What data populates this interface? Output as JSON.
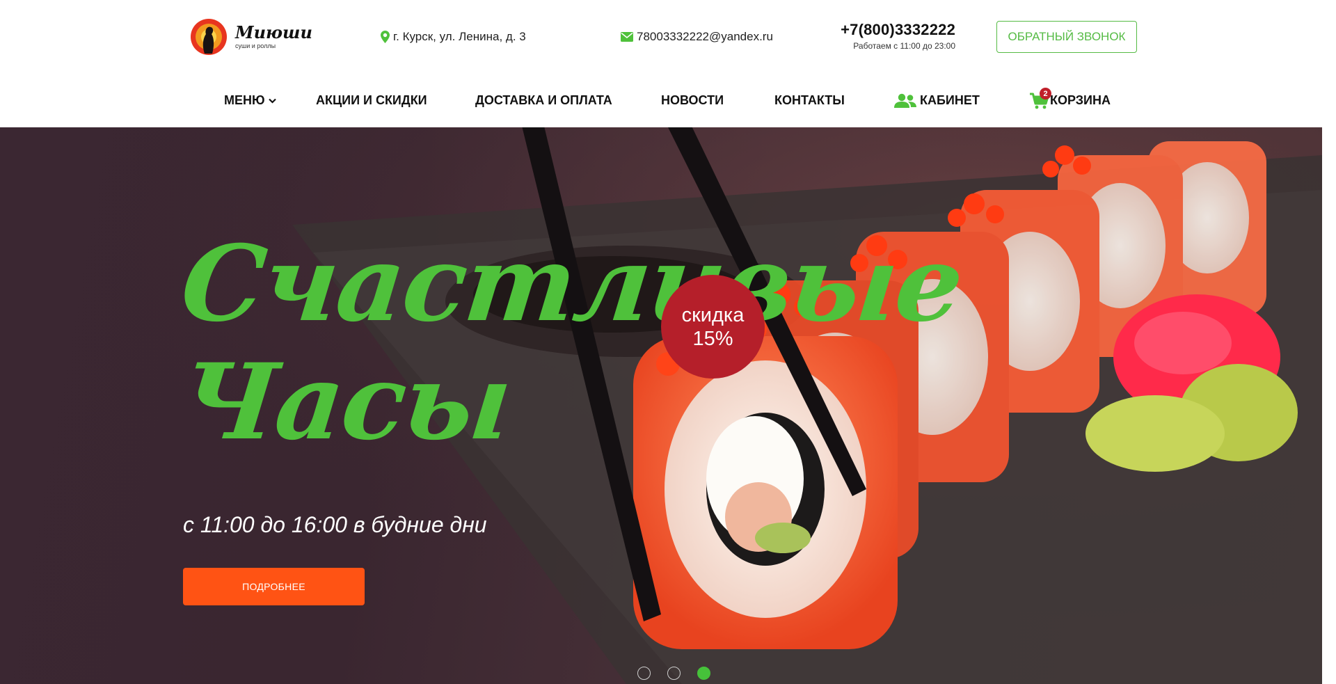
{
  "brand": {
    "name": "Миюши",
    "tagline": "суши и роллы"
  },
  "contacts": {
    "address": "г. Курск, ул. Ленина, д. 3",
    "email": "78003332222@yandex.ru",
    "phone": "+7(800)3332222",
    "hours": "Работаем с 11:00 до 23:00",
    "callback_label": "ОБРАТНЫЙ ЗВОНОК"
  },
  "nav": {
    "items": [
      {
        "label": "МЕНЮ"
      },
      {
        "label": "АКЦИИ И СКИДКИ"
      },
      {
        "label": "ДОСТАВКА И ОПЛАТА"
      },
      {
        "label": "НОВОСТИ"
      },
      {
        "label": "КОНТАКТЫ"
      },
      {
        "label": "КАБИНЕТ"
      },
      {
        "label": "КОРЗИНА"
      }
    ],
    "cart_count": "2"
  },
  "hero": {
    "title_line1": "Счастливые",
    "title_line2": "Часы",
    "discount_line1": "скидка",
    "discount_line2": "15%",
    "subtitle": "с 11:00 до 16:00 в будние дни",
    "button_label": "ПОДРОБНЕЕ",
    "slides_total": 3,
    "active_slide": 3
  },
  "colors": {
    "accent_green": "#4fc13b",
    "button_orange": "#ff5314",
    "badge_red": "#b51f2a",
    "hero_bg": "#3b2732"
  },
  "icons": {
    "address": "map-pin-icon",
    "email": "envelope-icon",
    "menu_dropdown": "chevron-down-icon",
    "cabinet": "users-icon",
    "cart": "shopping-cart-icon"
  }
}
